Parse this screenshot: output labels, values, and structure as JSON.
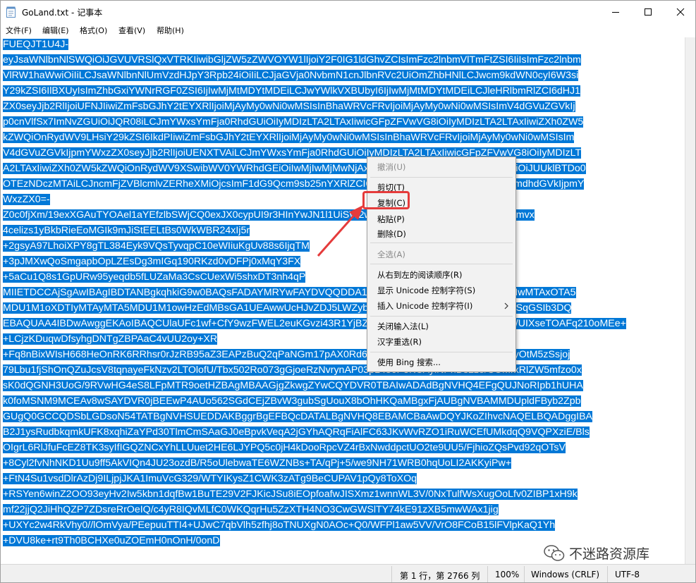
{
  "window": {
    "title": "GoLand.txt - 记事本",
    "buttons": [
      "minimize",
      "maximize",
      "close"
    ]
  },
  "menu": [
    "文件(F)",
    "编辑(E)",
    "格式(O)",
    "查看(V)",
    "帮助(H)"
  ],
  "text_lines": [
    "FUEQJT1U4J-",
    "eyJsaWNlbnNlSWQiOiJGVUVRSlQxVTRKIiwibGljZW5zZWVOYW1lIjoiY2F0IG1ldGhvZCIsImFzc2lnbmVlTmFtZSI6IiIsImFzc2lnbm",
    "VlRW1haWwiOiIiLCJsaWNlbnNlUmVzdHJpY3Rpb24iOiIiLCJjaGVja0NvbmN1cnJlbnRVc2UiOmZhbHNlLCJwcm9kdWN0cyI6W3si",
    "Y29kZSI6IlBXUyIsImZhbGxiYWNrRGF0ZSI6IjIwMjMtMDYtMDEiLCJwYWlkVXBUbyI6IjIwMjMtMDYtMDEiLCJleHRlbmRlZCI6dHJ1",
    "ZX0seyJjb2RlIjoiUFNJIiwiZmFsbGJhY2tEYXRlIjoiMjAyMy0wNi0wMSIsInBhaWRVcFRvIjoiMjAyMy0wNi0wMSIsImV4dGVuZGVkIj",
    "p0cnVlfSx7ImNvZGUiOiJQR08iLCJmYWxsYmFja0RhdGUiOiIyMDIzLTA2LTAxIiwicGFpZFVwVG8iOiIyMDIzLTA2LTAxIiwiZXh0ZW5",
    "kZWQiOnRydWV9LHsiY29kZSI6IkdPIiwiZmFsbGJhY2tEYXRlIjoiMjAyMy0wNi0wMSIsInBhaWRVcFRvIjoiMjAyMy0wNi0wMSIsIm",
    "V4dGVuZGVkIjpmYWxzZX0seyJjb2RlIjoiUENXTVAiLCJmYWxsYmFja0RhdGUiOiIyMDIzLTA2LTAxIiwicGFpZFVwVG8iOiIyMDIzLT",
    "A2LTAxIiwiZXh0ZW5kZWQiOnRydWV9XSwibWV0YWRhdGEiOiIwMjIwMjMwNjAxUFNBWDAwMDAwNSIsImhhc2giOiJUUklBTDo0",
    "OTEzNDczMTAiLCJncmFjZVBlcmlvZERheXMiOjcsImF1dG9Qcm9sb25nYXRlZCI6ZmFsc2UsImlzQXV0b1Byb2xvbmdhdGVkIjpmY",
    "WxzZX0=-",
    "Z0c0fjXm/19exXGAuTYOAel1aYEfzlbSWjCQ0exJX0cypUI9r3HInYwJN1l1UiSW2wYl7bEJeHJ52dzTUSCKtCDQRsjmvx",
    "4celizs1yBkbRieEoMGIk9mJiStEELtBs0WkWBR24xIj5r",
    "+2gsyA97LhoiXPY8gTL384Eyk9VQsTyvqpC10eWIiuKgUv88s6IjqTM",
    "+3pJMXwQoSmgapbOpLZEsDg3mIGq190RKzd0vDFPj0xMqY3FX",
    "+5aCu1Q8s1GpURw95yeqdb5fLUZaMa3CsCUexWi5shxDT3nh4qP",
    "MIIETDCCAjSgAwIBAgIBDTANBgkqhkiG9w0BAQsFADAYMRYwFAYDVQQDDA1KZXRQcm9maWxlIENBMB4XDTIwMTAxOTA5",
    "MDU1M1oXDTIyMTAyMTA5MDU1M1owHzEdMBsGA1UEAwwUcHJvZDJ5LWZyb20tMjAyMDEwMTkwggEiMA0GCSqGSIb3DQ",
    "EBAQUAA4IBDwAwggEKAoIBAQCUlaUFc1wf+CfY9wzFWEL2euKGvzi43R1YjBZ6RVnG4HOKuLUW0wKBQFH2A/UIXseTOAFq210oMEe+",
    "+LCjzKDuqwDfsyhgDNTgZBPAaC4vUU2oy+XR",
    "+Fq8nBixWIsH668HeOnRK6RRhsr0rJzRB95aZ3EAPzBuQ2qPaNGm17pAX0Rd6MQ+p4yNTUrA6aMEdPQEVN7uyOtM5zSsjoj",
    "79Lbu1fjShOnQZuJcsV8tqnayeFkNzv2LTOlofU/Tbx502Ro073gGjoeRzNvrynAP03pL486P3KCAyiNPhDs2z8/COMrxRlZW5mfzo0x",
    "sK0dQGNH3UoG/9RVwHG4eS8LFpMTR9oetHZBAgMBAAGjgZkwgZYwCQYDVR0TBAIwADAdBgNVHQ4EFgQUJNoRIpb1hUHA",
    "k0foMSNM9MCEAv8wSAYDVR0jBEEwP4AUo562SGdCEjZBvW3gubSgUouX8bOhHKQaMBgxFjAUBgNVBAMMDUpldFByb2Zpb",
    "GUgQ0GCCQDSbLGDsoN54TATBgNVHSUEDDAKBggrBgEFBQcDATALBgNVHQ8EBAMCBaAwDQYJKoZIhvcNAQELBQADggIBA",
    "B2J1ysRudbkqmkUFK8xqhiZaYPd30TlmCmSAaGJ0eBpvkVeqA2jGYhAQRqFiAlFC63JKvWvRZO1iRuWCEfUMkdqQ9VQPXziE/Bls",
    "OIgrL6RlJfuFcEZ8TK3syIfIGQZNCxYhLLUuet2HE6LJYPQ5c0jH4kDooRpcVZ4rBxNwddpctUO2te9UU5/FjhioZQsPvd92qOTsV",
    "+8Cyl2fvNhNKD1Uu9ff5AkVIQn4JU23ozdB/R5oUlebwaTE6WZNBs+TA/qPj+5/we9NH71WRB0hqUoLI2AKKyiPw+",
    "+FtN4Su1vsdDlrAzDj9ILjpjJKA1ImuVcG329/WTYIKysZ1CWK3zATg9BeCUPAV1pQy8ToXOq",
    "+RSYen6winZ2OO93eyHv2Iw5kbn1dqfBw1BuTE29V2FJKicJSu8iEOpfoafwJISXmz1wnnWL3V/0NxTulfWsXugOoLfv0ZIBP1xH9k",
    "mf22jjQ2JiHhQZP7ZDsreRrOeIQ/c4yR8IQvMLfC0WKQqrHu5ZzXTH4NO3CwGWSlTY74kE91zXB5mwWAx1jig",
    "+UXYc2w4RkVhy0//lOmVya/PEepuuTTI4+UJwC7qbVlh5zfhj8oTNUXgN0AOc+Q0/WFPl1aw5VV/VrO8FCoB15lFVlpKaQ1Yh",
    "+DVU8ke+rt9Th0BCHXe0uZOEmH0nOnH/0onD"
  ],
  "context_menu": {
    "items": [
      "撤消(U)",
      "剪切(T)",
      "复制(C)",
      "粘贴(P)",
      "删除(D)",
      "全选(A)",
      "从右到左的阅读顺序(R)",
      "显示 Unicode 控制字符(S)",
      "插入 Unicode 控制字符(I)",
      "关闭输入法(L)",
      "汉字重选(R)",
      "使用 Bing 搜索..."
    ],
    "disabled": [
      0,
      5
    ],
    "highlighted": "复制(C)"
  },
  "status": {
    "position": "第 1 行，第 2766 列",
    "zoom": "100%",
    "eol": "Windows (CRLF)",
    "encoding": "UTF-8"
  },
  "watermark": "不迷路资源库",
  "colors": {
    "selection": "#0078d7",
    "highlight_box": "#e53b3b",
    "arrow": "#e53b3b"
  }
}
